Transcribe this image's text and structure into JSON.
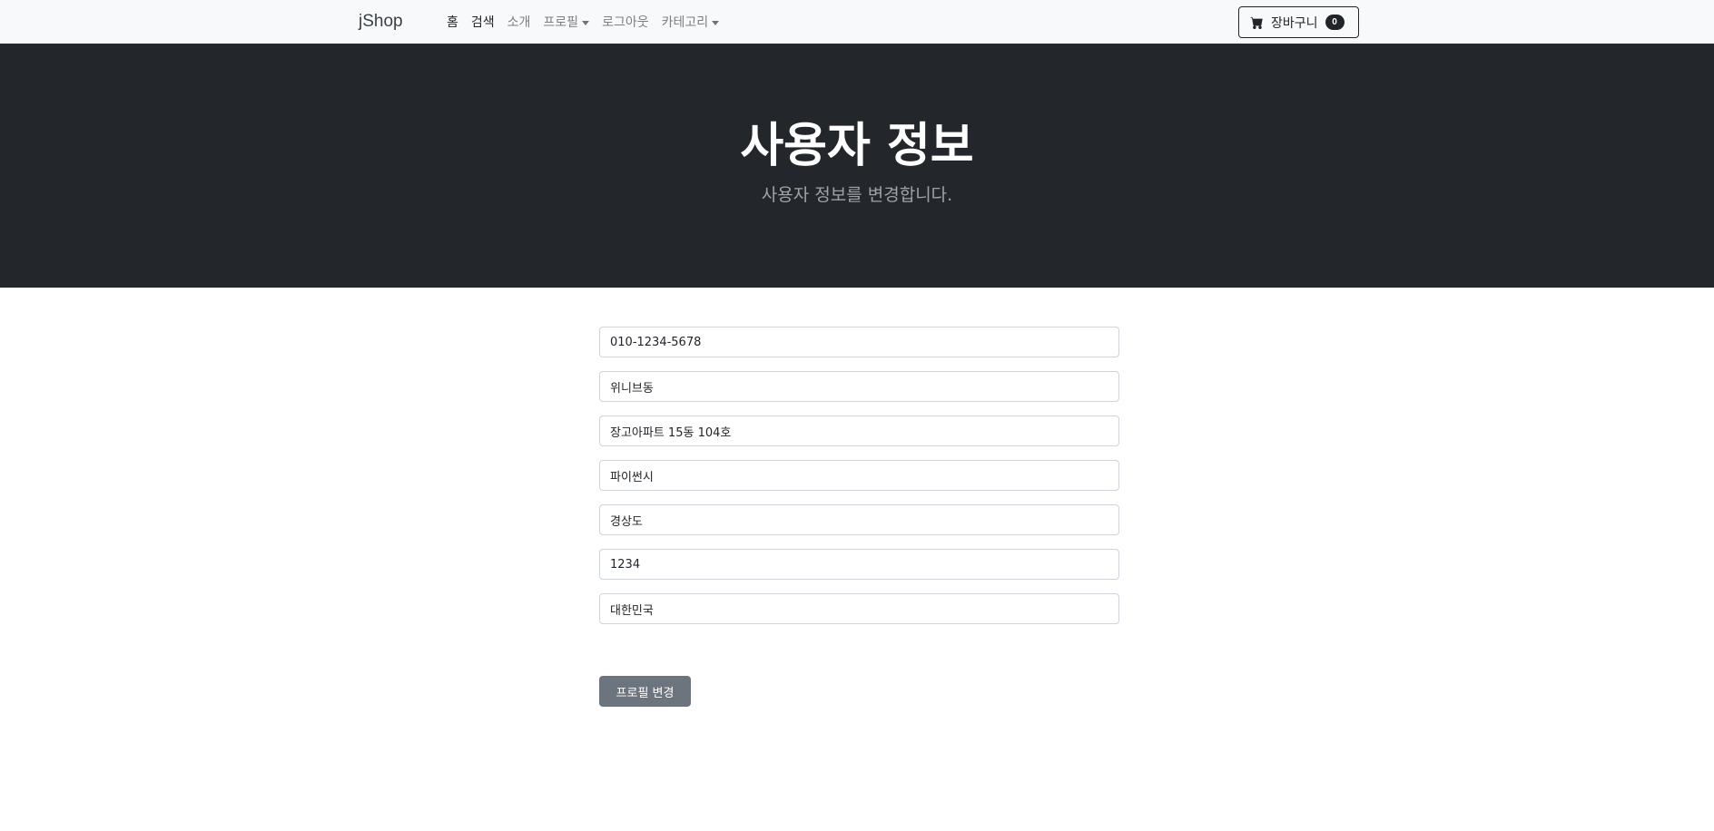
{
  "navbar": {
    "brand": "jShop",
    "items": [
      {
        "label": "홈",
        "active": true,
        "dropdown": false
      },
      {
        "label": "검색",
        "active": true,
        "dropdown": false
      },
      {
        "label": "소개",
        "active": false,
        "dropdown": false
      },
      {
        "label": "프로필",
        "active": false,
        "dropdown": true
      },
      {
        "label": "로그아웃",
        "active": false,
        "dropdown": false
      },
      {
        "label": "카테고리",
        "active": false,
        "dropdown": true
      }
    ],
    "cart": {
      "label": "장바구니",
      "count": "0",
      "icon": "cart-icon"
    }
  },
  "hero": {
    "title": "사용자 정보",
    "subtitle": "사용자 정보를 변경합니다."
  },
  "form": {
    "fields": [
      {
        "value": "010-1234-5678"
      },
      {
        "value": "위니브동"
      },
      {
        "value": "장고아파트 15동 104호"
      },
      {
        "value": "파이썬시"
      },
      {
        "value": "경상도"
      },
      {
        "value": "1234"
      },
      {
        "value": "대한민국"
      }
    ],
    "submit_label": "프로필 변경"
  },
  "colors": {
    "navbar_bg": "#f8f9fa",
    "hero_bg": "#23272c",
    "button_bg": "#6c757d",
    "badge_bg": "#212529"
  }
}
